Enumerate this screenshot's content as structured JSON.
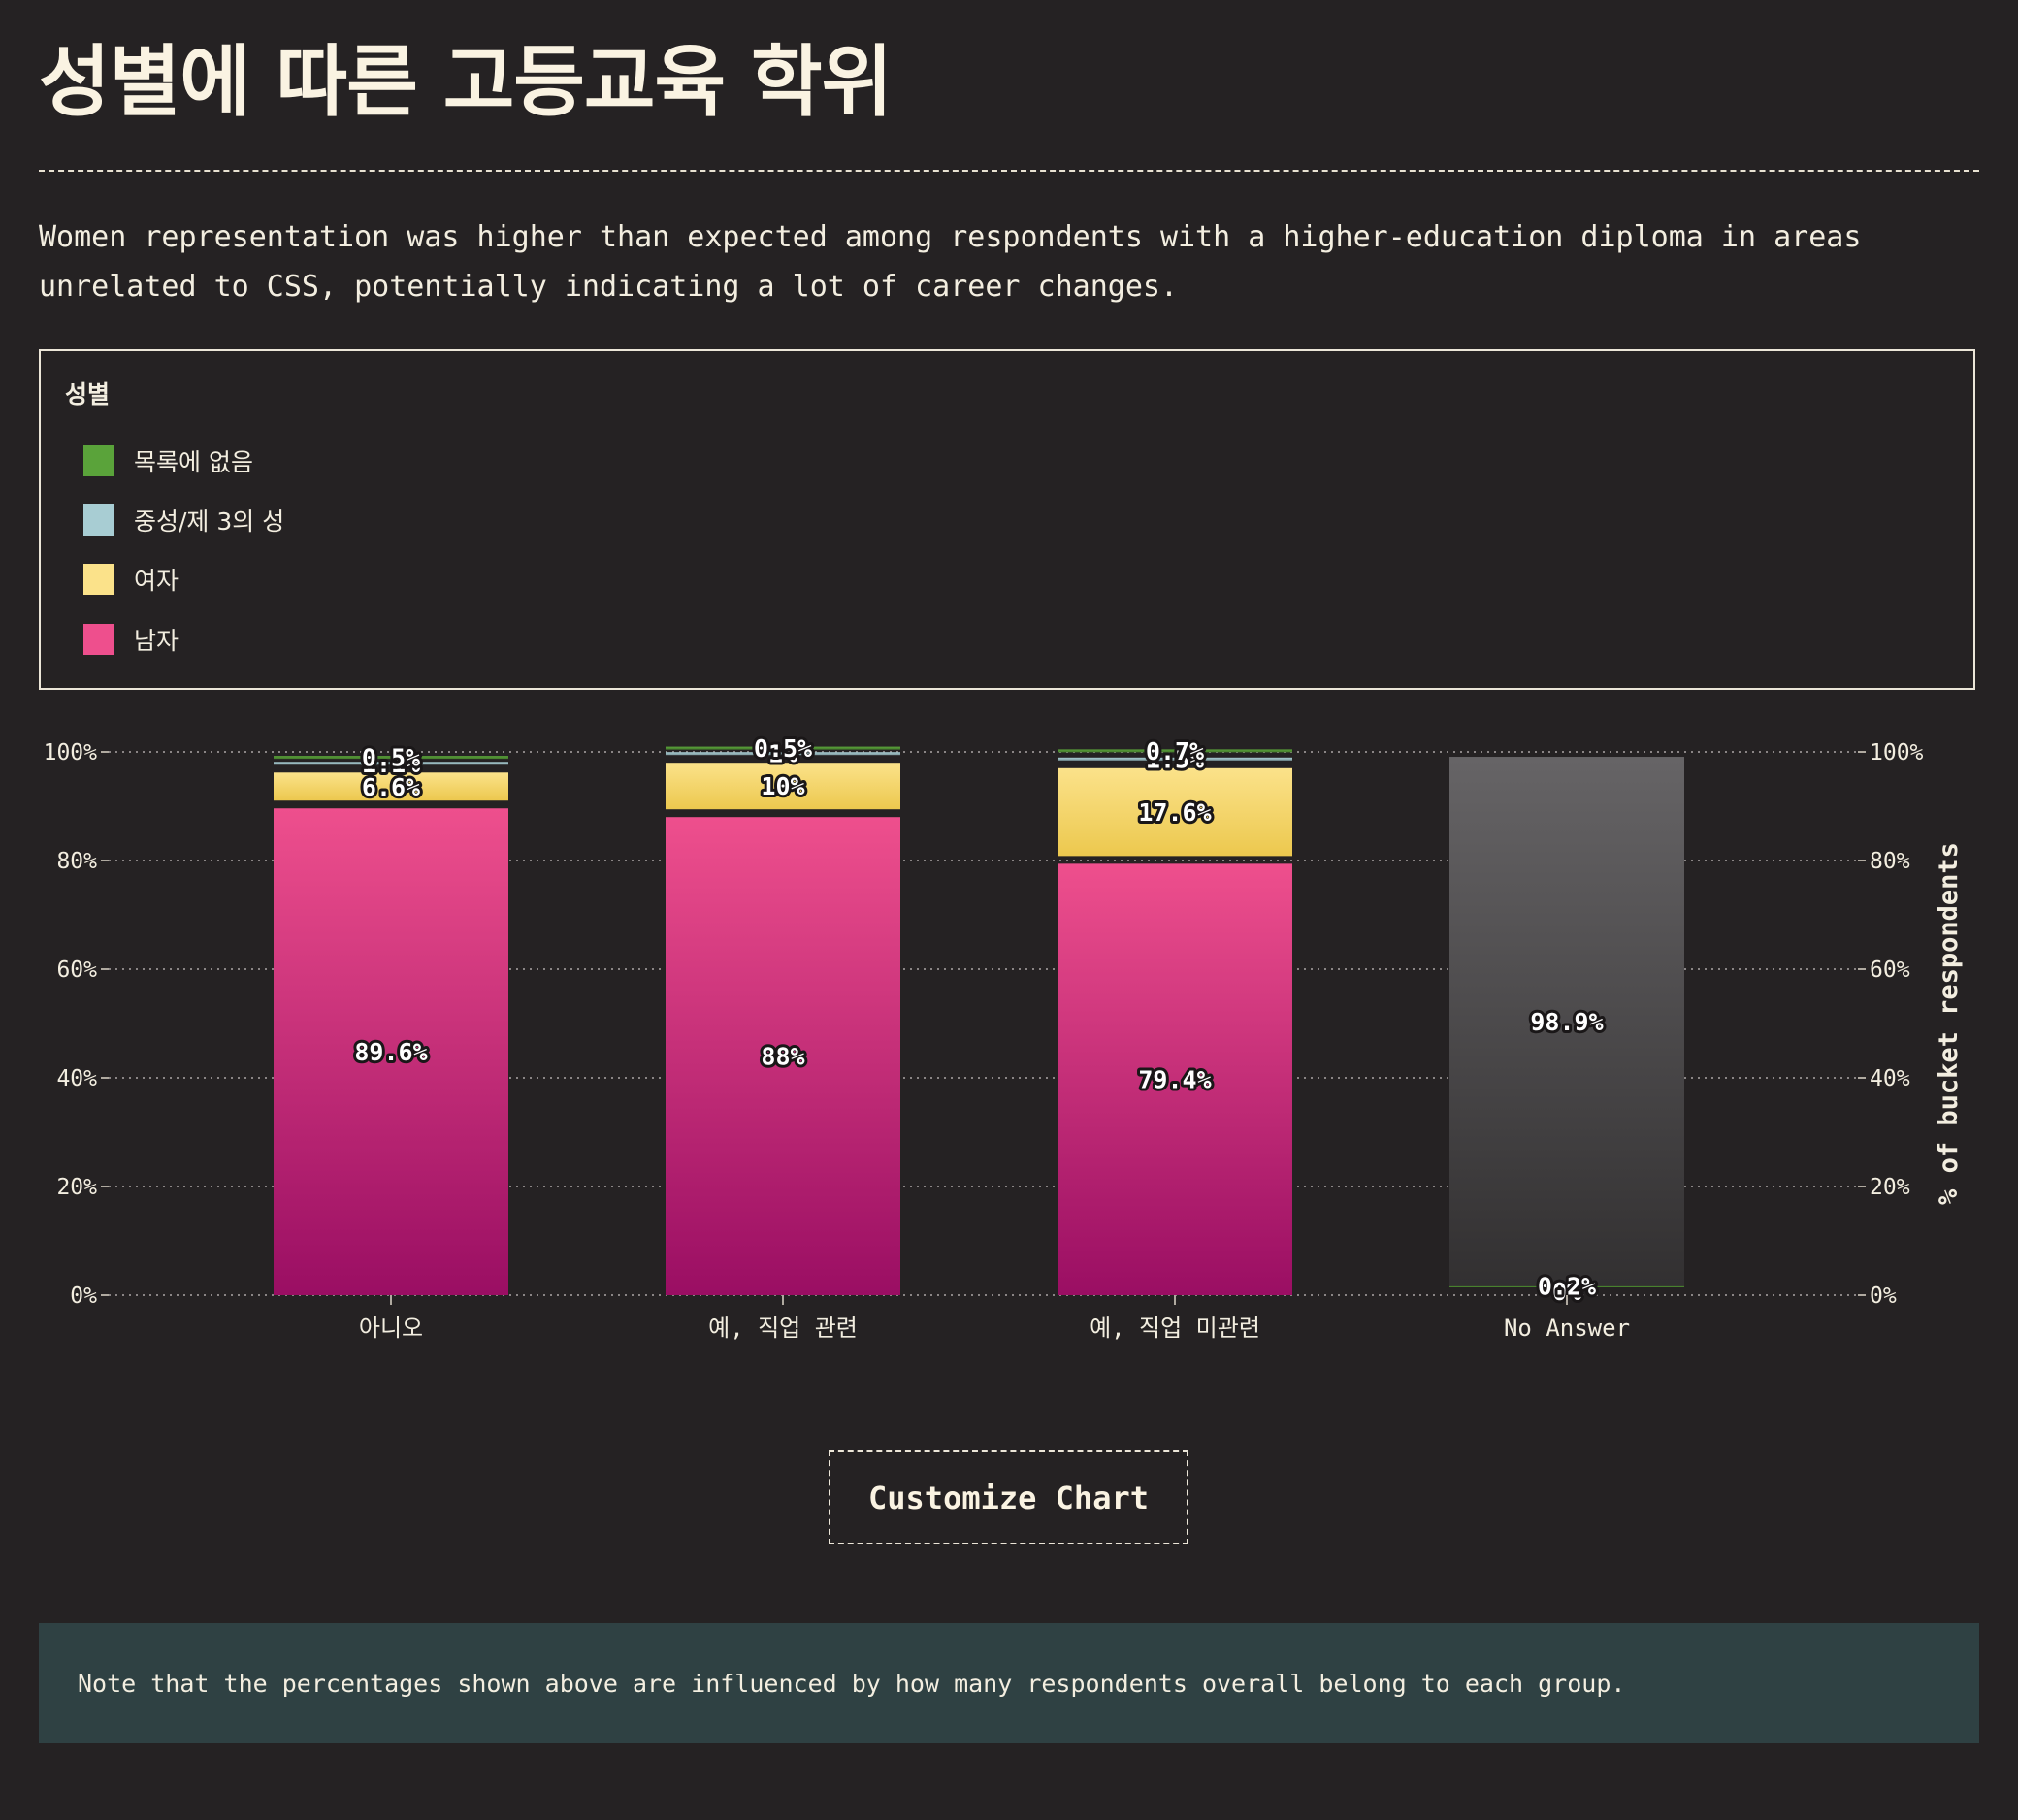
{
  "page": {
    "title": "성별에 따른 고등교육 학위",
    "description": "Women representation was higher than expected among respondents with a higher-education diploma in areas unrelated to CSS, potentially indicating a lot of career changes.",
    "customize_label": "Customize Chart",
    "note": "Note that the percentages shown above are influenced by how many respondents overall belong to each group."
  },
  "legend": {
    "title": "성별",
    "items": [
      {
        "label": "목록에 없음",
        "color": "#5aa33a"
      },
      {
        "label": "중성/제 3의 성",
        "color": "#a8cdd3"
      },
      {
        "label": "여자",
        "color": "#fbe28a"
      },
      {
        "label": "남자",
        "color": "#ee4f8d"
      }
    ]
  },
  "chart_data": {
    "type": "bar",
    "stacked": true,
    "categories": [
      "아니오",
      "예, 직업 관련",
      "예, 직업 미관련",
      "No Answer"
    ],
    "series": [
      {
        "name": "남자",
        "color": "#ee4f8d",
        "values": [
          89.6,
          88,
          79.4,
          0
        ],
        "labels": [
          "89.6%",
          "88%",
          "79.4%",
          "0%"
        ]
      },
      {
        "name": "여자",
        "color": "#fbe28a",
        "values": [
          6.6,
          10,
          17.6,
          0
        ],
        "labels": [
          "6.6%",
          "10%",
          "17.6%",
          "0%"
        ]
      },
      {
        "name": "중성/제 3의 성",
        "color": "#a8cdd3",
        "values": [
          1.1,
          1.0,
          1.5,
          0
        ],
        "labels": [
          "1.1%",
          "1%",
          "1.5%",
          ""
        ]
      },
      {
        "name": "목록에 없음",
        "color": "#5aa33a",
        "values": [
          0.5,
          0.5,
          0.7,
          0.2
        ],
        "labels": [
          "0.5%",
          "0.5%",
          "0.7%",
          "0.2%"
        ]
      },
      {
        "name": "No Answer",
        "color": "#666466",
        "values": [
          0,
          0,
          0,
          98.9
        ],
        "labels": [
          "",
          "",
          "",
          "98.9%"
        ]
      }
    ],
    "ylim": [
      0,
      100
    ],
    "yticks": [
      "0%",
      "20%",
      "40%",
      "60%",
      "80%",
      "100%"
    ],
    "ylabel": "% of bucket respondents",
    "xlabel": "",
    "grid": true
  }
}
